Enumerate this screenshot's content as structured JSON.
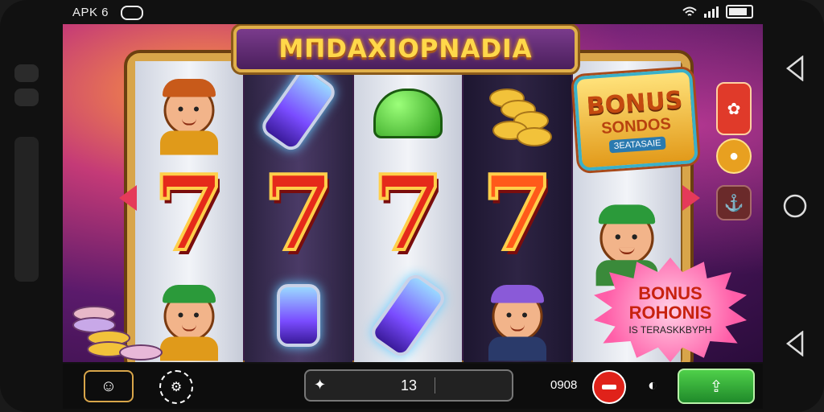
{
  "status_bar": {
    "left_text": "APK 6",
    "wifi_icon": "wifi-icon",
    "signal_icon": "signal-icon",
    "battery_icon": "battery-icon"
  },
  "game": {
    "title": "МПDAXІОРNADIA",
    "bonus_badge": {
      "line1": "BONUS",
      "line2": "SONDOS",
      "line3": "ЗEATASAIE"
    },
    "bonus_burst": {
      "line1": "BONUS",
      "line2": "ROHONIS",
      "line3": "IS TERASKKBYPH"
    },
    "reels": [
      [
        "worker-figure",
        "seven",
        "worker-figure"
      ],
      [
        "potion-vial",
        "seven",
        "potion-vial"
      ],
      [
        "green-helmet",
        "seven",
        "potion-vial"
      ],
      [
        "gold-coins",
        "seven",
        "woman-figure"
      ],
      [
        "bonus-badge",
        "worker-figure",
        "bonus-burst"
      ]
    ],
    "seven_symbol": "7",
    "side_buttons": [
      "menu-icon",
      "coin-icon",
      "anchor-icon"
    ]
  },
  "toolbar": {
    "bet_value": "13",
    "credit": "0908",
    "bet_icon": "chip-icon"
  },
  "colors": {
    "accent_gold": "#ffd84a",
    "seven_red": "#e52a1a",
    "spin_green": "#2fa83a",
    "stop_red": "#e0221a"
  }
}
